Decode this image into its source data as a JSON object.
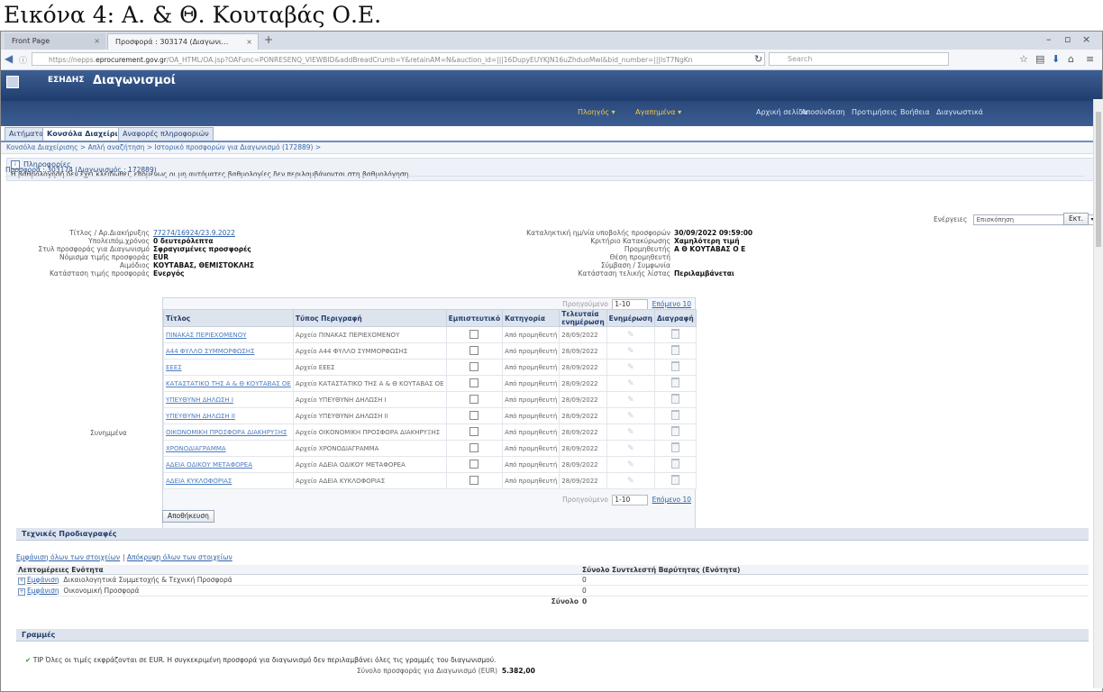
{
  "caption": "Εικόνα 4: Α. & Θ. Κουταβάς Ο.Ε.",
  "browser": {
    "tabs": [
      {
        "label": "Front Page"
      },
      {
        "label": "Προσφορά : 303174 (Διαγωνι..."
      }
    ],
    "new_tab": "+",
    "url_prefix": "https://nepps.",
    "url_domain": "eprocurement.gov.gr",
    "url_rest": "/OA_HTML/OA.jsp?OAFunc=PONRESENQ_VIEWBID&addBreadCrumb=Y&retainAM=N&auction_id=|||16DupyEUYKJN16uZhduoMwl&bid_number=|||IsT7NgKn",
    "search_placeholder": "Search"
  },
  "app": {
    "brand": "ΕΣΗΔΗΣ",
    "title": "Διαγωνισμοί",
    "global_links": [
      "Αρχική σελίδα",
      "Αποσύνδεση",
      "Προτιμήσεις",
      "Βοήθεια",
      "Διαγνωστικά"
    ],
    "nav_menus": [
      "Πλοηγός ▾",
      "Αγαπημένα ▾"
    ],
    "tabs": [
      "Αιτήματα",
      "Κονσόλα Διαχείρισης",
      "Αναφορές πληροφοριών"
    ],
    "breadcrumbs": "Κονσόλα Διαχείρισης >  Απλή αναζήτηση >  Ιστορικό προσφορών για Διαγωνισμό (172889) >"
  },
  "info": {
    "title": "Πληροφορίες",
    "text": "Η βαθμολόγηση δεν έχει κλειδωθεί, επομένως οι μη αυτόματες βαθμολογίες δεν περιλαμβάνονται στη βαθμολόγηση."
  },
  "offer_header": "Προσφορά : 303174 (Διαγωνισμός : 172889)",
  "actions": {
    "label": "Ενέργειες",
    "value": "Επισκόπηση",
    "go": "Εκτ."
  },
  "left_fields": [
    {
      "label": "Τίτλος / Αρ.Διακήρυξης",
      "value": "77274/16924/23.9.2022",
      "link": true
    },
    {
      "label": "Υπολειπόμ.χρόνος",
      "value": "0 δευτερόλεπτα"
    },
    {
      "label": "Στυλ προσφοράς για Διαγωνισμό",
      "value": "Σφραγισμένες προσφορές"
    },
    {
      "label": "Νόμισμα τιμής προσφοράς",
      "value": "EUR"
    },
    {
      "label": "Αιμόδιος",
      "value": "ΚΟΥΤΑΒΑΣ, ΘΕΜΙΣΤΟΚΛΗΣ"
    },
    {
      "label": "Κατάσταση τιμής προσφοράς",
      "value": "Ενεργός"
    }
  ],
  "right_fields": [
    {
      "label": "Καταληκτική ημ/νία υποβολής προσφορών",
      "value": "30/09/2022 09:59:00"
    },
    {
      "label": "Κριτήριο Κατακύρωσης",
      "value": "Χαμηλότερη τιμή"
    },
    {
      "label": "Προμηθευτής",
      "value": "Α Θ ΚΟΥΤΑΒΑΣ Ο Ε"
    },
    {
      "label": "Θέση προμηθευτή",
      "value": ""
    },
    {
      "label": "Σύμβαση / Συμφωνία",
      "value": ""
    },
    {
      "label": "Κατάσταση τελικής λίστας",
      "value": "Περιλαμβάνεται"
    }
  ],
  "attachments_label": "Συνημμένα",
  "pager": {
    "prev": "Προηγούμενο",
    "range": "1-10",
    "next": "Επόμενο 10"
  },
  "docs_columns": [
    "Τίτλος",
    "Τύπος Περιγραφή",
    "Εμπιστευτικό",
    "Κατηγορία",
    "Τελευταία ενημέρωση",
    "Ενημέρωση",
    "Διαγραφή"
  ],
  "docs": [
    {
      "title": "ΠΙΝΑΚΑΣ ΠΕΡΙΕΧΟΜΕΝΟΥ",
      "type": "Αρχείο",
      "desc": "ΠΙΝΑΚΑΣ ΠΕΡΙΕΧΟΜΕΝΟΥ",
      "cat": "Από προμηθευτή",
      "date": "28/09/2022"
    },
    {
      "title": "Α44 ΦΥΛΛΟ ΣΥΜΜΟΡΦΩΣΗΣ",
      "type": "Αρχείο",
      "desc": "Α44 ΦΥΛΛΟ ΣΥΜΜΟΡΦΩΣΗΣ",
      "cat": "Από προμηθευτή",
      "date": "28/09/2022"
    },
    {
      "title": "ΕΕΕΣ",
      "type": "Αρχείο",
      "desc": "ΕΕΕΣ",
      "cat": "Από προμηθευτή",
      "date": "28/09/2022"
    },
    {
      "title": "ΚΑΤΑΣΤΑΤΙΚΟ ΤΗΣ Α & Θ ΚΟΥΤΑΒΑΣ ΟΕ",
      "type": "Αρχείο",
      "desc": "ΚΑΤΑΣΤΑΤΙΚΟ ΤΗΣ Α & Θ ΚΟΥΤΑΒΑΣ ΟΕ",
      "cat": "Από προμηθευτή",
      "date": "28/09/2022"
    },
    {
      "title": "ΥΠΕΥΘΥΝΗ ΔΗΛΩΣΗ Ι",
      "type": "Αρχείο",
      "desc": "ΥΠΕΥΘΥΝΗ ΔΗΛΩΣΗ Ι",
      "cat": "Από προμηθευτή",
      "date": "28/09/2022"
    },
    {
      "title": "ΥΠΕΥΘΥΝΗ ΔΗΛΩΣΗ ΙΙ",
      "type": "Αρχείο",
      "desc": "ΥΠΕΥΘΥΝΗ ΔΗΛΩΣΗ ΙΙ",
      "cat": "Από προμηθευτή",
      "date": "28/09/2022"
    },
    {
      "title": "ΟΙΚΟΝΟΜΙΚΗ ΠΡΟΣΦΟΡΑ ΔΙΑΚΗΡΥΞΗΣ",
      "type": "Αρχείο",
      "desc": "ΟΙΚΟΝΟΜΙΚΗ ΠΡΟΣΦΟΡΑ ΔΙΑΚΗΡΥΞΗΣ",
      "cat": "Από προμηθευτή",
      "date": "28/09/2022"
    },
    {
      "title": "ΧΡΟΝΟΔΙΑΓΡΑΜΜΑ",
      "type": "Αρχείο",
      "desc": "ΧΡΟΝΟΔΙΑΓΡΑΜΜΑ",
      "cat": "Από προμηθευτή",
      "date": "28/09/2022"
    },
    {
      "title": "ΑΔΕΙΑ ΟΔΙΚΟΥ ΜΕΤΑΦΟΡΕΑ",
      "type": "Αρχείο",
      "desc": "ΑΔΕΙΑ ΟΔΙΚΟΥ ΜΕΤΑΦΟΡΕΑ",
      "cat": "Από προμηθευτή",
      "date": "28/09/2022"
    },
    {
      "title": "ΑΔΕΙΑ ΚΥΚΛΟΦΟΡΙΑΣ",
      "type": "Αρχείο",
      "desc": "ΑΔΕΙΑ ΚΥΚΛΟΦΟΡΙΑΣ",
      "cat": "Από προμηθευτή",
      "date": "28/09/2022"
    }
  ],
  "save_button": "Αποθήκευση",
  "specs": {
    "title": "Τεχνικές Προδιαγραφές",
    "expand_all": "Εμφάνιση όλων των στοιχείων",
    "collapse_all": "Απόκρυψη όλων των στοιχείων",
    "col_unit": "Λεπτομέρειες Ενότητα",
    "col_total": "Σύνολο Συντελεστή Βαρύτητας (Ενότητα)",
    "rows": [
      {
        "link": "Εμφάνιση",
        "name": "Δικαιολογητικά Συμμετοχής & Τεχνική Προσφορά",
        "value": "0"
      },
      {
        "link": "Εμφάνιση",
        "name": "Οικονομική Προσφορά",
        "value": "0"
      }
    ],
    "sum_label": "Σύνολο",
    "sum_value": "0"
  },
  "lines": {
    "title": "Γραμμές",
    "tip": "TIP Όλες οι τιμές εκφράζονται σε EUR. Η συγκεκριμένη προσφορά για διαγωνισμό δεν περιλαμβάνει όλες τις γραμμές του διαγωνισμού.",
    "total_label": "Σύνολο προσφοράς για Διαγωνισμό (EUR)",
    "total_value": "5.382,00"
  }
}
